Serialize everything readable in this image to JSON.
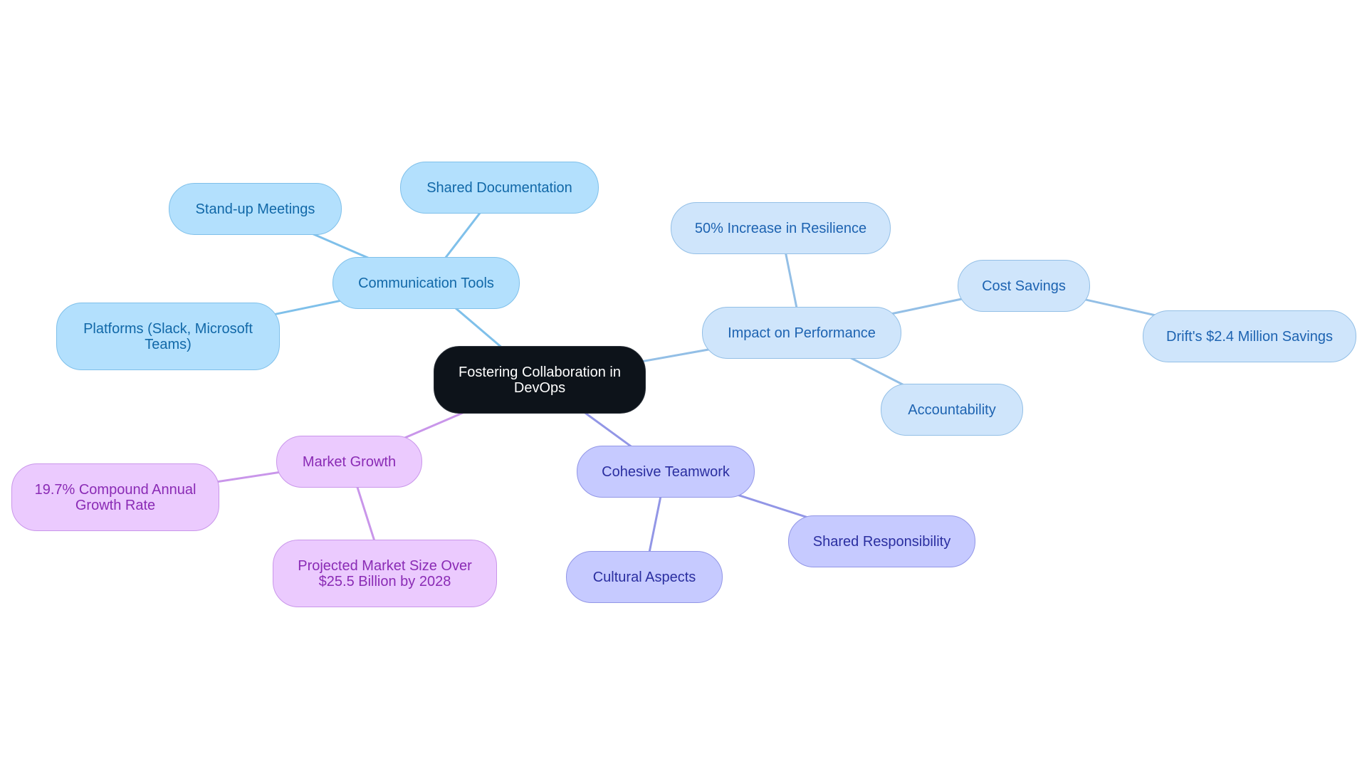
{
  "diagram": {
    "title": "Fostering Collaboration in DevOps",
    "root": {
      "id": "root",
      "label": "Fostering Collaboration in DevOps"
    },
    "branches": [
      {
        "id": "comm",
        "label": "Communication Tools",
        "color": "#7fc0ea",
        "children": [
          {
            "id": "standup",
            "label": "Stand-up Meetings"
          },
          {
            "id": "shareddoc",
            "label": "Shared Documentation"
          },
          {
            "id": "platforms",
            "label": "Platforms (Slack, Microsoft Teams)"
          }
        ]
      },
      {
        "id": "impact",
        "label": "Impact on Performance",
        "color": "#93bfe6",
        "children": [
          {
            "id": "resilience",
            "label": "50% Increase in Resilience"
          },
          {
            "id": "cost",
            "label": "Cost Savings",
            "children": [
              {
                "id": "drift",
                "label": "Drift's $2.4 Million Savings"
              }
            ]
          },
          {
            "id": "account",
            "label": "Accountability"
          }
        ]
      },
      {
        "id": "team",
        "label": "Cohesive Teamwork",
        "color": "#9296e6",
        "children": [
          {
            "id": "sharedresp",
            "label": "Shared Responsibility"
          },
          {
            "id": "cultural",
            "label": "Cultural Aspects"
          }
        ]
      },
      {
        "id": "market",
        "label": "Market Growth",
        "color": "#c996ea",
        "children": [
          {
            "id": "cagr",
            "label": "19.7% Compound Annual Growth Rate"
          },
          {
            "id": "projected",
            "label": "Projected Market Size Over $25.5 Billion by 2028"
          }
        ]
      }
    ]
  }
}
